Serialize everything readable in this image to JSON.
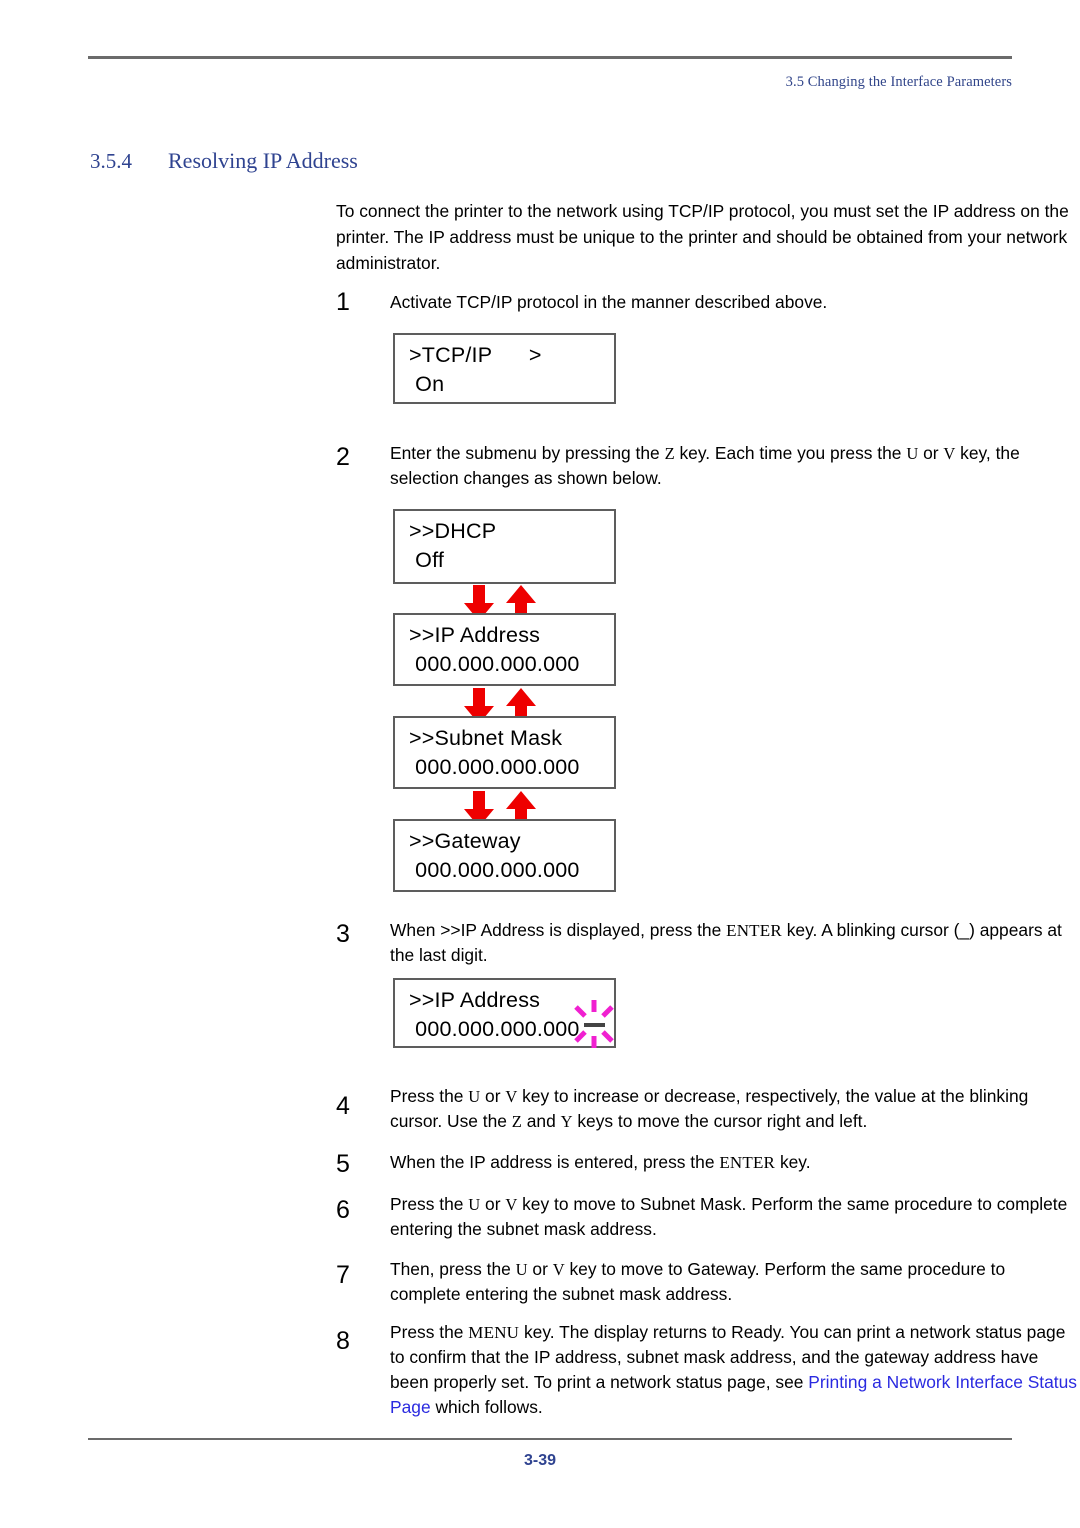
{
  "header": {
    "running_title": "3.5 Changing the Interface Parameters"
  },
  "section": {
    "number": "3.5.4",
    "title": "Resolving IP Address"
  },
  "intro": "To connect the printer to the network using TCP/IP protocol, you must set the IP address on the printer. The IP address must be unique to the printer and should be obtained from your network administrator.",
  "steps": [
    {
      "number": "1",
      "text": "Activate TCP/IP protocol in the manner described above."
    },
    {
      "number": "2",
      "text_a": "Enter the submenu by pressing the ",
      "key_z": "Z",
      "text_b": " key. Each time you press the ",
      "key_u": "U",
      "text_c": " or ",
      "key_v": "V",
      "text_d": " key, the selection changes as shown below."
    },
    {
      "number": "3",
      "text_a": "When ",
      "panel_ref": ">>IP Address",
      "text_b": " is displayed, press the ",
      "key_enter": "ENTER",
      "text_c": " key. A blinking cursor (_) appears at the last digit."
    },
    {
      "number": "4",
      "text_a": "Press the ",
      "key_u": "U",
      "text_b": " or ",
      "key_v": "V",
      "text_c": " key to increase or decrease, respectively, the value at the blinking cursor. Use the ",
      "key_z": "Z",
      "text_d": " and ",
      "key_y": "Y",
      "text_e": " keys to move the cursor right and left."
    },
    {
      "number": "5",
      "text_a": "When the IP address is entered, press the ",
      "key_enter": "ENTER",
      "text_b": " key."
    },
    {
      "number": "6",
      "text_a": "Press the ",
      "key_u": "U",
      "text_b": " or ",
      "key_v": "V",
      "text_c": " key to move to ",
      "panel_ref": "Subnet Mask",
      "text_d": ". Perform the same procedure to complete entering the subnet mask address."
    },
    {
      "number": "7",
      "text_a": "Then, press the ",
      "key_u": "U",
      "text_b": " or ",
      "key_v": "V",
      "text_c": " key to move to ",
      "panel_ref": "Gateway",
      "text_d": ". Perform the same procedure to complete entering the subnet mask address."
    },
    {
      "number": "8",
      "text_a": "Press the ",
      "key_menu": "MENU",
      "text_b": " key. The display returns to ",
      "ready": "Ready",
      "text_c": ". You can print a network status page to confirm that the IP address, subnet mask address, and the gateway address have been properly set. To print a network status page, see ",
      "link": "Printing a Network Interface Status Page",
      "text_d": " which follows."
    }
  ],
  "panels": {
    "tcpip": {
      "line1": ">TCP/IP      >",
      "line2": " On"
    },
    "dhcp": {
      "line1": ">>DHCP",
      "line2": " Off"
    },
    "ip_address": {
      "line1": ">>IP Address",
      "line2": " 000.000.000.000"
    },
    "subnet_mask": {
      "line1": ">>Subnet Mask",
      "line2": " 000.000.000.000"
    },
    "gateway": {
      "line1": ">>Gateway",
      "line2": " 000.000.000.000"
    },
    "ip_address_blink": {
      "line1": ">>IP Address",
      "line2": " 000.000.000.000"
    }
  },
  "colors": {
    "heading": "#2f4390",
    "arrow_red": "#ee0000",
    "blink_magenta": "#f020d0",
    "link_blue": "#2a2ae0",
    "rule_gray": "#6b6b6b",
    "lcd_border": "#5d5d5d"
  },
  "footer": {
    "page_number": "3-39"
  }
}
